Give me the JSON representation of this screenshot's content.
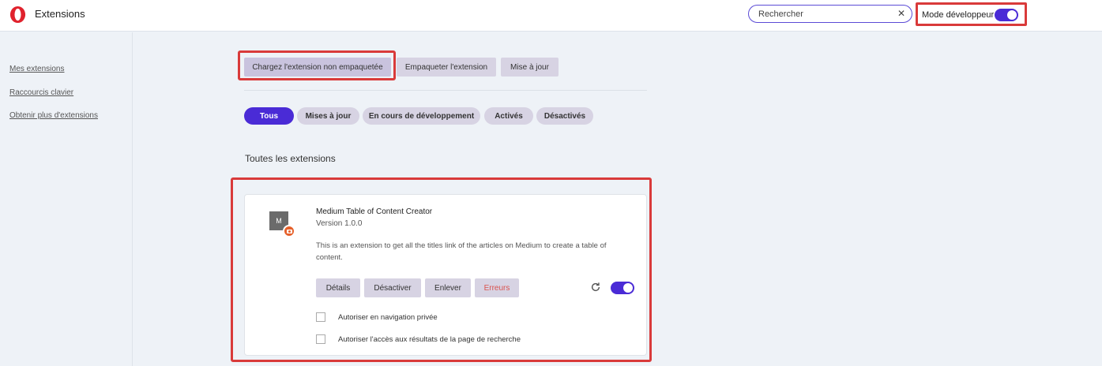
{
  "header": {
    "title": "Extensions"
  },
  "search": {
    "placeholder": "Rechercher"
  },
  "dev_mode": {
    "label": "Mode développeur",
    "enabled": true
  },
  "sidebar": {
    "items": [
      {
        "label": "Mes extensions"
      },
      {
        "label": "Raccourcis clavier"
      },
      {
        "label": "Obtenir plus d'extensions"
      }
    ]
  },
  "toolbar": {
    "load_unpacked": "Chargez l'extension non empaquetée",
    "pack": "Empaqueter l'extension",
    "update": "Mise à jour"
  },
  "filters": [
    "Tous",
    "Mises à jour",
    "En cours de développement",
    "Activés",
    "Désactivés"
  ],
  "section": {
    "title": "Toutes les extensions"
  },
  "extension": {
    "icon_letter": "M",
    "name": "Medium Table of Content Creator",
    "version": "Version 1.0.0",
    "description": "This is an extension to get all the titles link of the articles on Medium to create a table of content.",
    "buttons": {
      "details": "Détails",
      "disable": "Désactiver",
      "remove": "Enlever",
      "errors": "Erreurs"
    },
    "enabled": true,
    "options": [
      {
        "label": "Autoriser en navigation privée",
        "checked": false
      },
      {
        "label": "Autoriser l'accès aux résultats de la page de recherche",
        "checked": false
      }
    ]
  },
  "colors": {
    "accent": "#4a2bd6",
    "highlight": "#d93a3a",
    "button_bg": "#d7d3e3",
    "error_text": "#d9534f"
  },
  "icons": {
    "logo": "opera-logo-icon",
    "clear": "close-icon",
    "refresh": "refresh-icon"
  }
}
